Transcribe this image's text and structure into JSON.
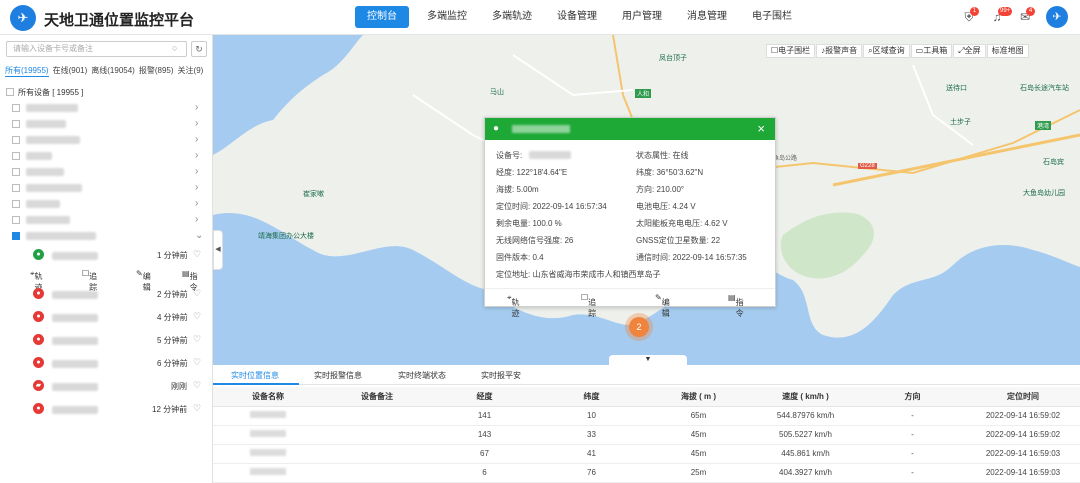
{
  "header": {
    "title": "天地卫通位置监控平台",
    "nav": [
      "控制台",
      "多端监控",
      "多端轨迹",
      "设备管理",
      "用户管理",
      "消息管理",
      "电子围栏"
    ],
    "badges": {
      "alarm": "1",
      "notice": "99+",
      "message": "4"
    }
  },
  "sidebar": {
    "search_placeholder": "请输入设备卡号或备注",
    "tabs": [
      "所有(19955)",
      "在线(901)",
      "离线(19054)",
      "报警(895)",
      "关注(9)"
    ],
    "root_label": "所有设备 [ 19955 ]",
    "ops": {
      "track": "轨迹",
      "trace": "追踪",
      "edit": "编辑",
      "command": "指令"
    },
    "devices": [
      {
        "time": "1 分钟前",
        "status_color": "#22a046"
      },
      {
        "time": "2 分钟前",
        "status_color": "#e53935"
      },
      {
        "time": "4 分钟前",
        "status_color": "#e53935"
      },
      {
        "time": "5 分钟前",
        "status_color": "#e53935"
      },
      {
        "time": "6 分钟前",
        "status_color": "#e53935"
      },
      {
        "time": "刚刚",
        "status_color": "#e53935"
      },
      {
        "time": "12 分钟前",
        "status_color": "#e53935"
      }
    ]
  },
  "map": {
    "toolbar": [
      "电子围栏",
      "报警声音",
      "区域查询",
      "工具箱",
      "全屏",
      "标准地图"
    ],
    "cluster_count": "2",
    "labels": {
      "l1": "马山",
      "l2": "凤台顶子",
      "l3": "送待口",
      "l4": "石岛长途汽车站",
      "l5": "土步子",
      "l6": "崔家嗽",
      "l7": "靖海集团办公大楼",
      "l8": "大鱼岛幼儿园",
      "l9": "石岛宾",
      "l10": "人和",
      "l11": "港湾",
      "l12": "G228",
      "l13": "鱼岛公路"
    }
  },
  "popup": {
    "device_no_label": "设备号:",
    "status": "状态属性: 在线",
    "lng": "经度: 122°18'4.64\"E",
    "lat": "纬度: 36°50'3.62\"N",
    "alt": "海拔: 5.00m",
    "dir": "方向: 210.00°",
    "fix_time": "定位时间: 2022-09-14 16:57:34",
    "battery_v": "电池电压: 4.24 V",
    "battery": "剩余电量: 100.0 %",
    "solar": "太阳能板充电电压: 4.62 V",
    "signal": "无线网络信号强度: 26",
    "gnss": "GNSS定位卫星数量: 22",
    "firmware": "固件版本: 0.4",
    "comm_time": "通信时间: 2022-09-14 16:57:35",
    "address": "定位地址: 山东省威海市荣成市人和镇西草岛子",
    "ops": {
      "track": "轨迹",
      "trace": "追踪",
      "edit": "编辑",
      "command": "指令"
    }
  },
  "bottom": {
    "tabs": [
      "实时位置信息",
      "实时报警信息",
      "实时终端状态",
      "实时报平安"
    ],
    "columns": [
      "设备名称",
      "设备备注",
      "经度",
      "纬度",
      "海拔 ( m )",
      "速度 ( km/h )",
      "方向",
      "定位时间"
    ],
    "rows": [
      {
        "lng": "141",
        "lat": "10",
        "alt": "65m",
        "speed": "544.87976 km/h",
        "dir": "-",
        "time": "2022-09-14 16:59:02"
      },
      {
        "lng": "143",
        "lat": "33",
        "alt": "45m",
        "speed": "505.5227 km/h",
        "dir": "-",
        "time": "2022-09-14 16:59:02"
      },
      {
        "lng": "67",
        "lat": "41",
        "alt": "45m",
        "speed": "445.861 km/h",
        "dir": "-",
        "time": "2022-09-14 16:59:03"
      },
      {
        "lng": "6",
        "lat": "76",
        "alt": "25m",
        "speed": "404.3927 km/h",
        "dir": "-",
        "time": "2022-09-14 16:59:03"
      }
    ]
  }
}
